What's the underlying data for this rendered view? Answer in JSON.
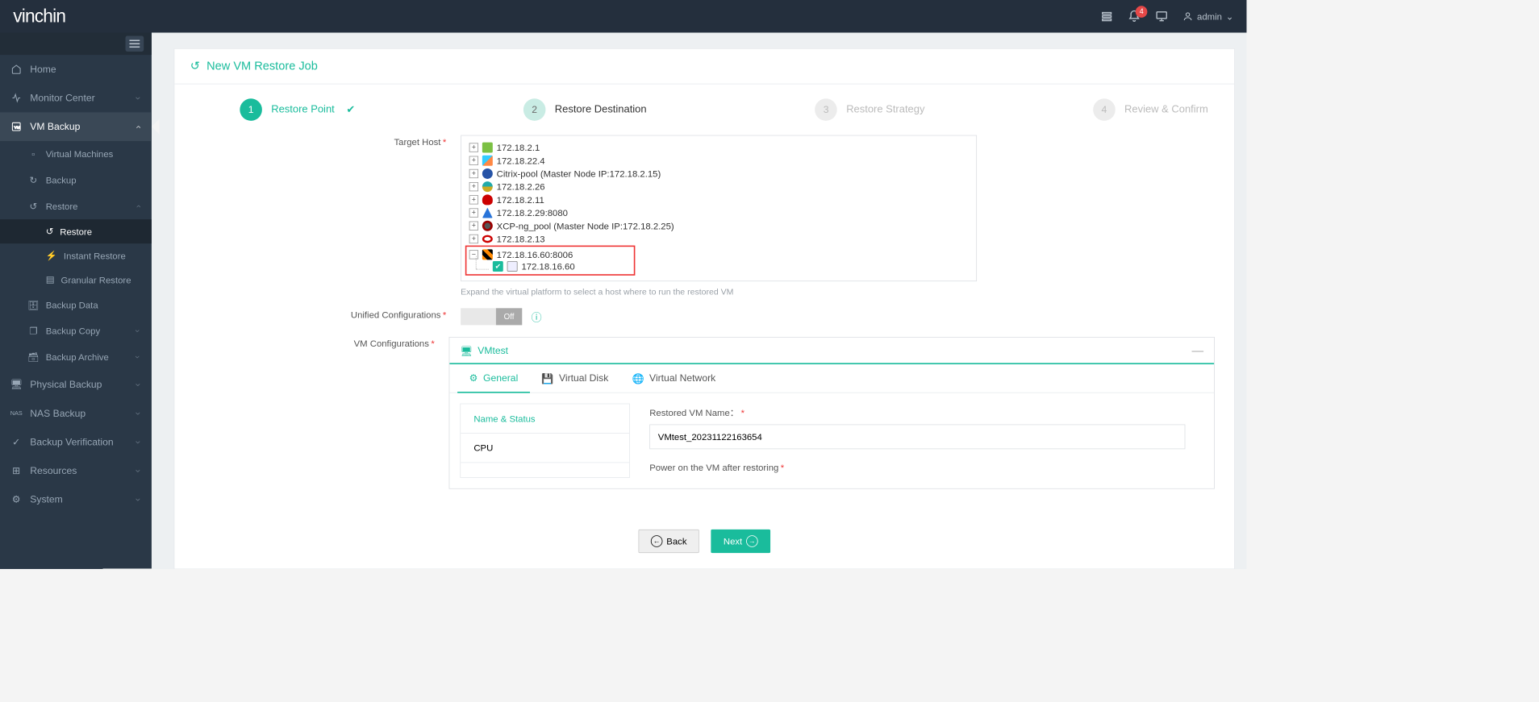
{
  "brand": "vinchin",
  "notifications": 4,
  "user": {
    "name": "admin"
  },
  "sidebar": {
    "home": "Home",
    "monitor": "Monitor Center",
    "vm_backup": "VM Backup",
    "virtual_machines": "Virtual Machines",
    "backup": "Backup",
    "restore": "Restore",
    "restore2": "Restore",
    "instant_restore": "Instant Restore",
    "granular_restore": "Granular Restore",
    "backup_data": "Backup Data",
    "backup_copy": "Backup Copy",
    "backup_archive": "Backup Archive",
    "physical_backup": "Physical Backup",
    "nas_backup": "NAS Backup",
    "backup_verification": "Backup Verification",
    "resources": "Resources",
    "system": "System"
  },
  "page": {
    "title": "New VM Restore Job",
    "steps": [
      {
        "num": "1",
        "label": "Restore Point",
        "state": "done"
      },
      {
        "num": "2",
        "label": "Restore Destination",
        "state": "current"
      },
      {
        "num": "3",
        "label": "Restore Strategy",
        "state": "pending"
      },
      {
        "num": "4",
        "label": "Review & Confirm",
        "state": "pending"
      }
    ],
    "target_host_label": "Target Host",
    "tree": [
      {
        "label": "172.18.2.1",
        "icon": "vmware"
      },
      {
        "label": "172.18.22.4",
        "icon": "hyperv"
      },
      {
        "label": "Citrix-pool (Master Node IP:172.18.2.15)",
        "icon": "citrix"
      },
      {
        "label": "172.18.2.26",
        "icon": "sangfor"
      },
      {
        "label": "172.18.2.11",
        "icon": "redhat"
      },
      {
        "label": "172.18.2.29:8080",
        "icon": "azure"
      },
      {
        "label": "XCP-ng_pool (Master Node IP:172.18.2.25)",
        "icon": "xcp"
      },
      {
        "label": "172.18.2.13",
        "icon": "olvm"
      }
    ],
    "selected_host_parent": "172.18.16.60:8006",
    "selected_host_child": "172.18.16.60",
    "tree_hint": "Expand the virtual platform to select a host where to run the restored VM",
    "unified_label": "Unified Configurations",
    "unified_toggle": "Off",
    "vmconfig_label": "VM Configurations",
    "vm_name": "VMtest",
    "tabs": {
      "general": "General",
      "virtual_disk": "Virtual Disk",
      "virtual_network": "Virtual Network"
    },
    "left_tabs": {
      "name_status": "Name & Status",
      "cpu": "CPU"
    },
    "restored_vm_name_label": "Restored VM Name：",
    "restored_vm_name": "VMtest_20231122163654",
    "power_on_label": "Power on the VM after restoring",
    "back": "Back",
    "next": "Next"
  }
}
